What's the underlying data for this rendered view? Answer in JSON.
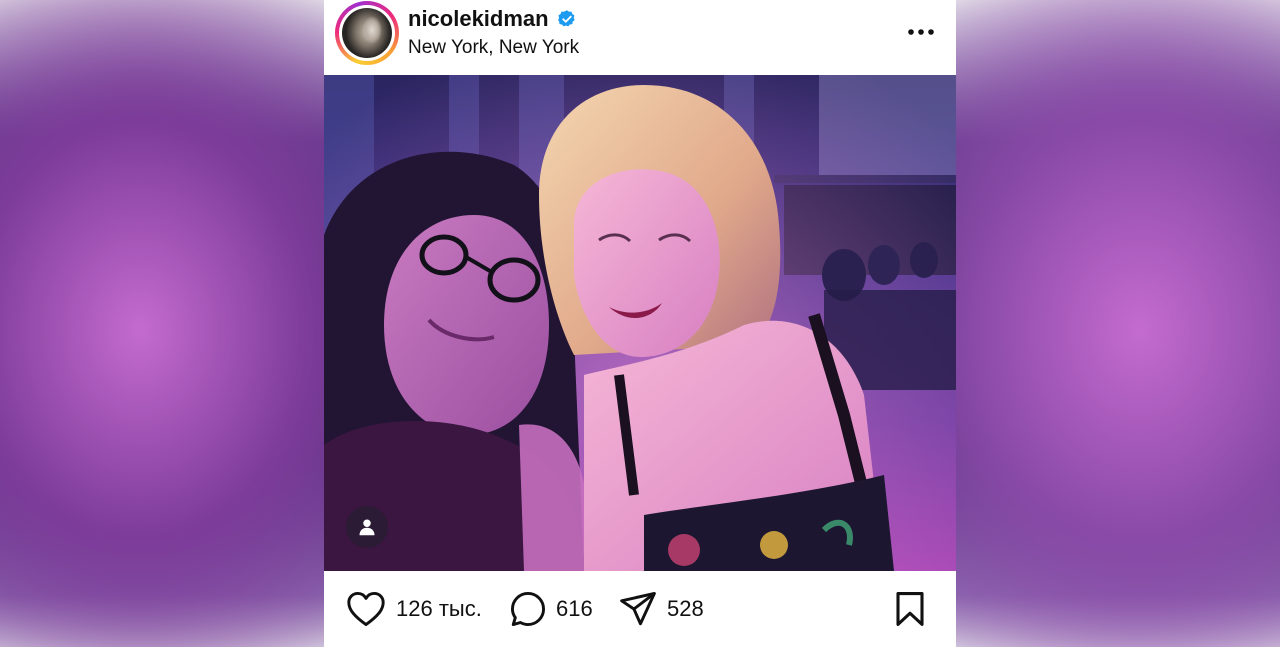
{
  "post": {
    "username": "nicolekidman",
    "location": "New York, New York",
    "likes": "126 тыс.",
    "comments": "616",
    "shares": "528"
  },
  "icons": {
    "verified": "verified-badge-icon",
    "more": "more-horizontal-icon",
    "like": "heart-icon",
    "comment": "comment-bubble-icon",
    "share": "paper-plane-icon",
    "save": "bookmark-icon",
    "tag": "user-tag-icon"
  },
  "colors": {
    "verified": "#1d9bf0",
    "text": "#111111"
  }
}
